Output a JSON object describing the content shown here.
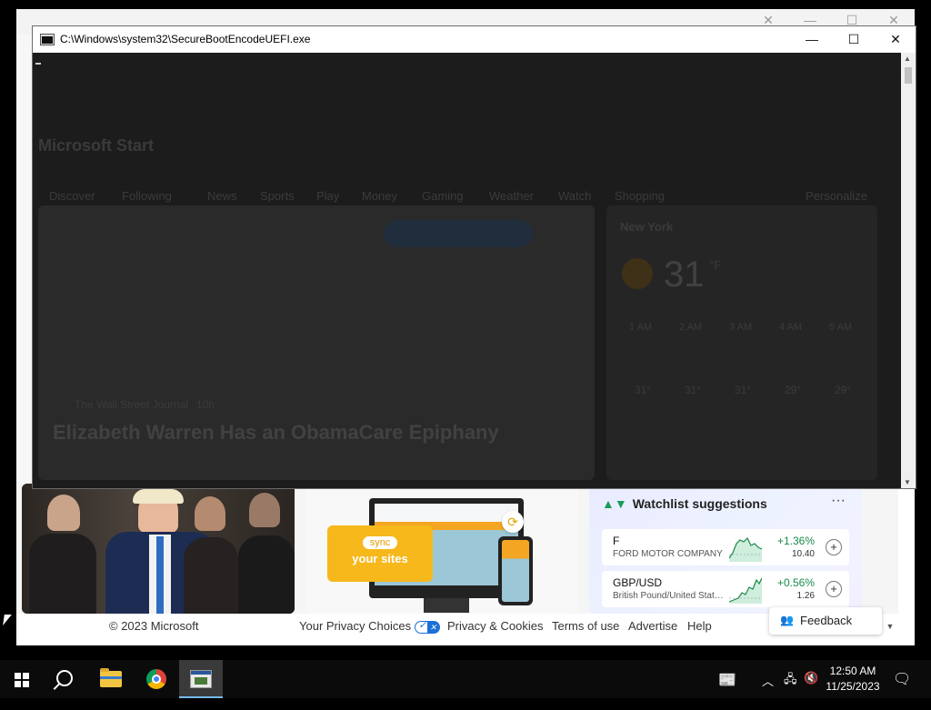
{
  "console": {
    "title": "C:\\Windows\\system32\\SecureBootEncodeUEFI.exe",
    "minimize_icon": "minimize-icon",
    "maximize_icon": "maximize-icon",
    "close_icon": "close-icon"
  },
  "background_page": {
    "brand": "Microsoft Start",
    "nav": [
      "Discover",
      "Following",
      "News",
      "Sports",
      "Play",
      "Money",
      "Gaming",
      "Weather",
      "Watch",
      "Shopping"
    ],
    "personalize": "Personalize",
    "hero_source": "The Wall Street Journal",
    "hero_age": "10h",
    "hero_headline": "Elizabeth Warren Has an ObamaCare Epiphany",
    "weather_city": "New York",
    "weather_temp": "31",
    "weather_unit": "°F",
    "hours": [
      "1 AM",
      "2 AM",
      "3 AM",
      "4 AM",
      "5 AM"
    ],
    "temps": [
      "31°",
      "31°",
      "31°",
      "29°",
      "29°"
    ]
  },
  "sync_card": {
    "pill": "sync",
    "text": "your sites"
  },
  "watchlist": {
    "title": "Watchlist suggestions",
    "more": "···",
    "items": [
      {
        "symbol": "F",
        "name": "FORD MOTOR COMPANY",
        "change": "+1.36%",
        "price": "10.40"
      },
      {
        "symbol": "GBP/USD",
        "name": "British Pound/United States Dollar",
        "change": "+0.56%",
        "price": "1.26"
      }
    ]
  },
  "footer": {
    "copyright": "© 2023 Microsoft",
    "privacy_choices": "Your Privacy Choices",
    "privacy_cookies": "Privacy & Cookies",
    "terms": "Terms of use",
    "advertise": "Advertise",
    "help": "Help",
    "feedback": "Feedback"
  },
  "taskbar": {
    "time": "12:50 AM",
    "date": "11/25/2023"
  },
  "colors": {
    "console_body": "#1c1c1c",
    "gain_green": "#1a8a4a",
    "taskbar": "#0b0b0b",
    "accent": "#76b9ed"
  }
}
